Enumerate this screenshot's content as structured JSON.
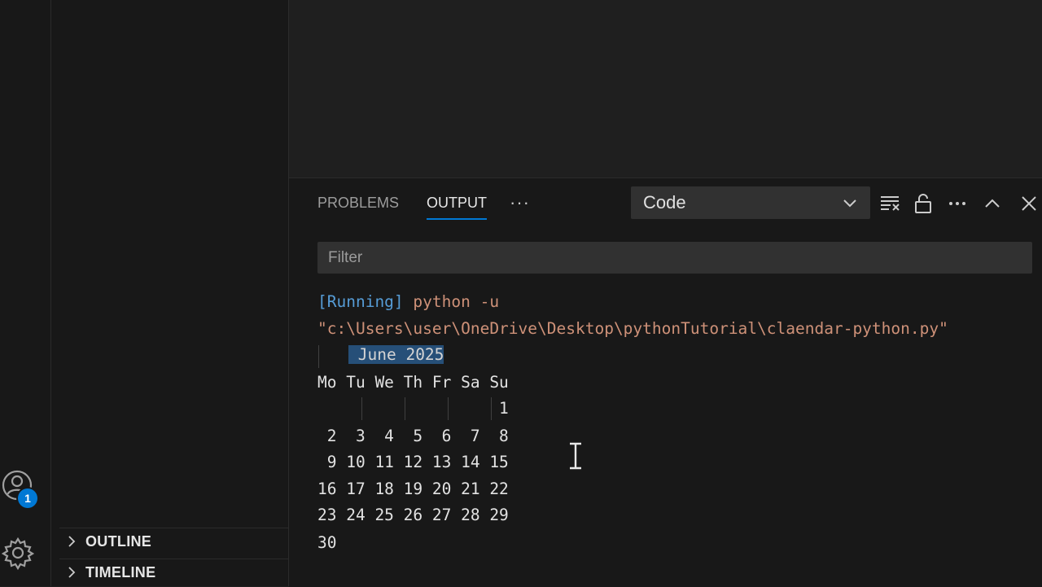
{
  "panel": {
    "tabs": [
      {
        "label": "PROBLEMS",
        "active": false
      },
      {
        "label": "OUTPUT",
        "active": true
      }
    ],
    "more_label": "···",
    "channel_select": {
      "value": "Code"
    },
    "filter_placeholder": "Filter"
  },
  "sidebar": {
    "sections": [
      {
        "label": "OUTLINE"
      },
      {
        "label": "TIMELINE"
      }
    ]
  },
  "activity_bar": {
    "account_badge": "1"
  },
  "output": {
    "running_tag": "[Running]",
    "running_cmd": "python -u",
    "script_path": "\"c:\\Users\\user\\OneDrive\\Desktop\\pythonTutorial\\claendar-python.py\"",
    "calendar": {
      "month_title": "June 2025",
      "weekday_header": "Mo Tu We Th Fr Sa Su",
      "weeks": [
        "                   1",
        " 2  3  4  5  6  7  8",
        " 9 10 11 12 13 14 15",
        "16 17 18 19 20 21 22",
        "23 24 25 26 27 28 29",
        "30"
      ]
    }
  },
  "colors": {
    "accent": "#0078d4",
    "selection": "#264f78",
    "string": "#ce9178",
    "keyword": "#569cd6"
  }
}
